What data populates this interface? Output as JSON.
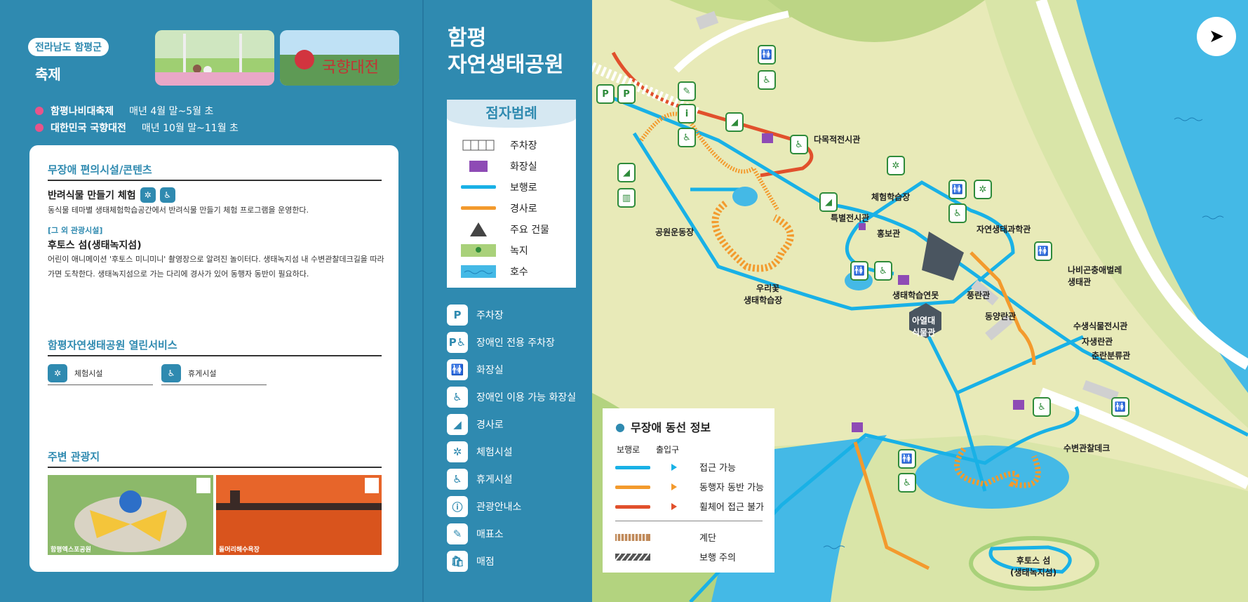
{
  "left": {
    "region_badge": "전라남도 함평군",
    "festival_title": "축제",
    "festivals": [
      {
        "name": "함평나비대축제",
        "date": "매년 4월 말~5월 초"
      },
      {
        "name": "대한민국 국향대전",
        "date": "매년 10월 말~11월 초"
      }
    ],
    "accessible": {
      "title": "무장애 편의시설/콘텐츠",
      "item1_title": "반려식물 만들기 체험",
      "item1_desc": "동식물 테마별 생태체험학습공간에서 반려식물 만들기 체험 프로그램을 운영한다.",
      "other_tag": "[그 외 관광시설]",
      "item2_title": "후토스 섬(생태녹지섬)",
      "item2_desc": "어린이 애니메이션 '후토스 미니미니' 촬영장으로 알려진 놀이터다. 생태녹지섬 내 수변관찰데크길을 따라가면 도착한다. 생태녹지섬으로 가는 다리에 경사가 있어 동행자 동반이 필요하다."
    },
    "services": {
      "title": "함평자연생태공원 열린서비스",
      "items": [
        "체험시설",
        "휴게시설"
      ]
    },
    "nearby": {
      "title": "주변 관광지",
      "items": [
        "함평엑스포공원",
        "돌머리해수욕장"
      ]
    }
  },
  "middle": {
    "park_title_line1": "함평",
    "park_title_line2": "자연생태공원",
    "legend_title": "점자범례",
    "legend": [
      "주차장",
      "화장실",
      "보행로",
      "경사로",
      "주요 건물",
      "녹지",
      "호수"
    ],
    "icons": [
      "주차장",
      "장애인 전용 주차장",
      "화장실",
      "장애인 이용 가능 화장실",
      "경사로",
      "체험시설",
      "휴게시설",
      "관광안내소",
      "매표소",
      "매점"
    ]
  },
  "map": {
    "labels": {
      "dasaek": "다목적전시관",
      "chehum": "체험학습장",
      "teukbyeol": "특별전시관",
      "hongbo": "홍보관",
      "gongwon": "공원운동장",
      "urikkot1": "우리꽃",
      "urikkot2": "생태학습장",
      "saengtae_pond": "생태학습연못",
      "jayeon": "자연생태과학관",
      "punglan": "풍란관",
      "nabi1": "나비곤충애벌레",
      "nabi2": "생태관",
      "dongyang": "동양란관",
      "yeoldae1": "아열대",
      "yeoldae2": "식물관",
      "susaeng": "수생식물전시관",
      "jasaeng": "자생란관",
      "chunran": "춘란분류관",
      "subyeon": "수변관찰데크",
      "hutos1": "후토스 섬",
      "hutos2": "(생태녹지섬)"
    },
    "route_info": {
      "title": "무장애 동선 정보",
      "col1": "보행로",
      "col2": "출입구",
      "rows": [
        "접근 가능",
        "동행자 동반 가능",
        "휠체어 접근 불가",
        "계단",
        "보행 주의"
      ]
    }
  },
  "colors": {
    "panel_blue": "#2f8ab0",
    "path_blue": "#19b1e6",
    "path_orange": "#f39a2d",
    "path_red": "#e1502c",
    "land": "#f0ecc0",
    "green": "#a9d17a",
    "water": "#44b9e6"
  }
}
